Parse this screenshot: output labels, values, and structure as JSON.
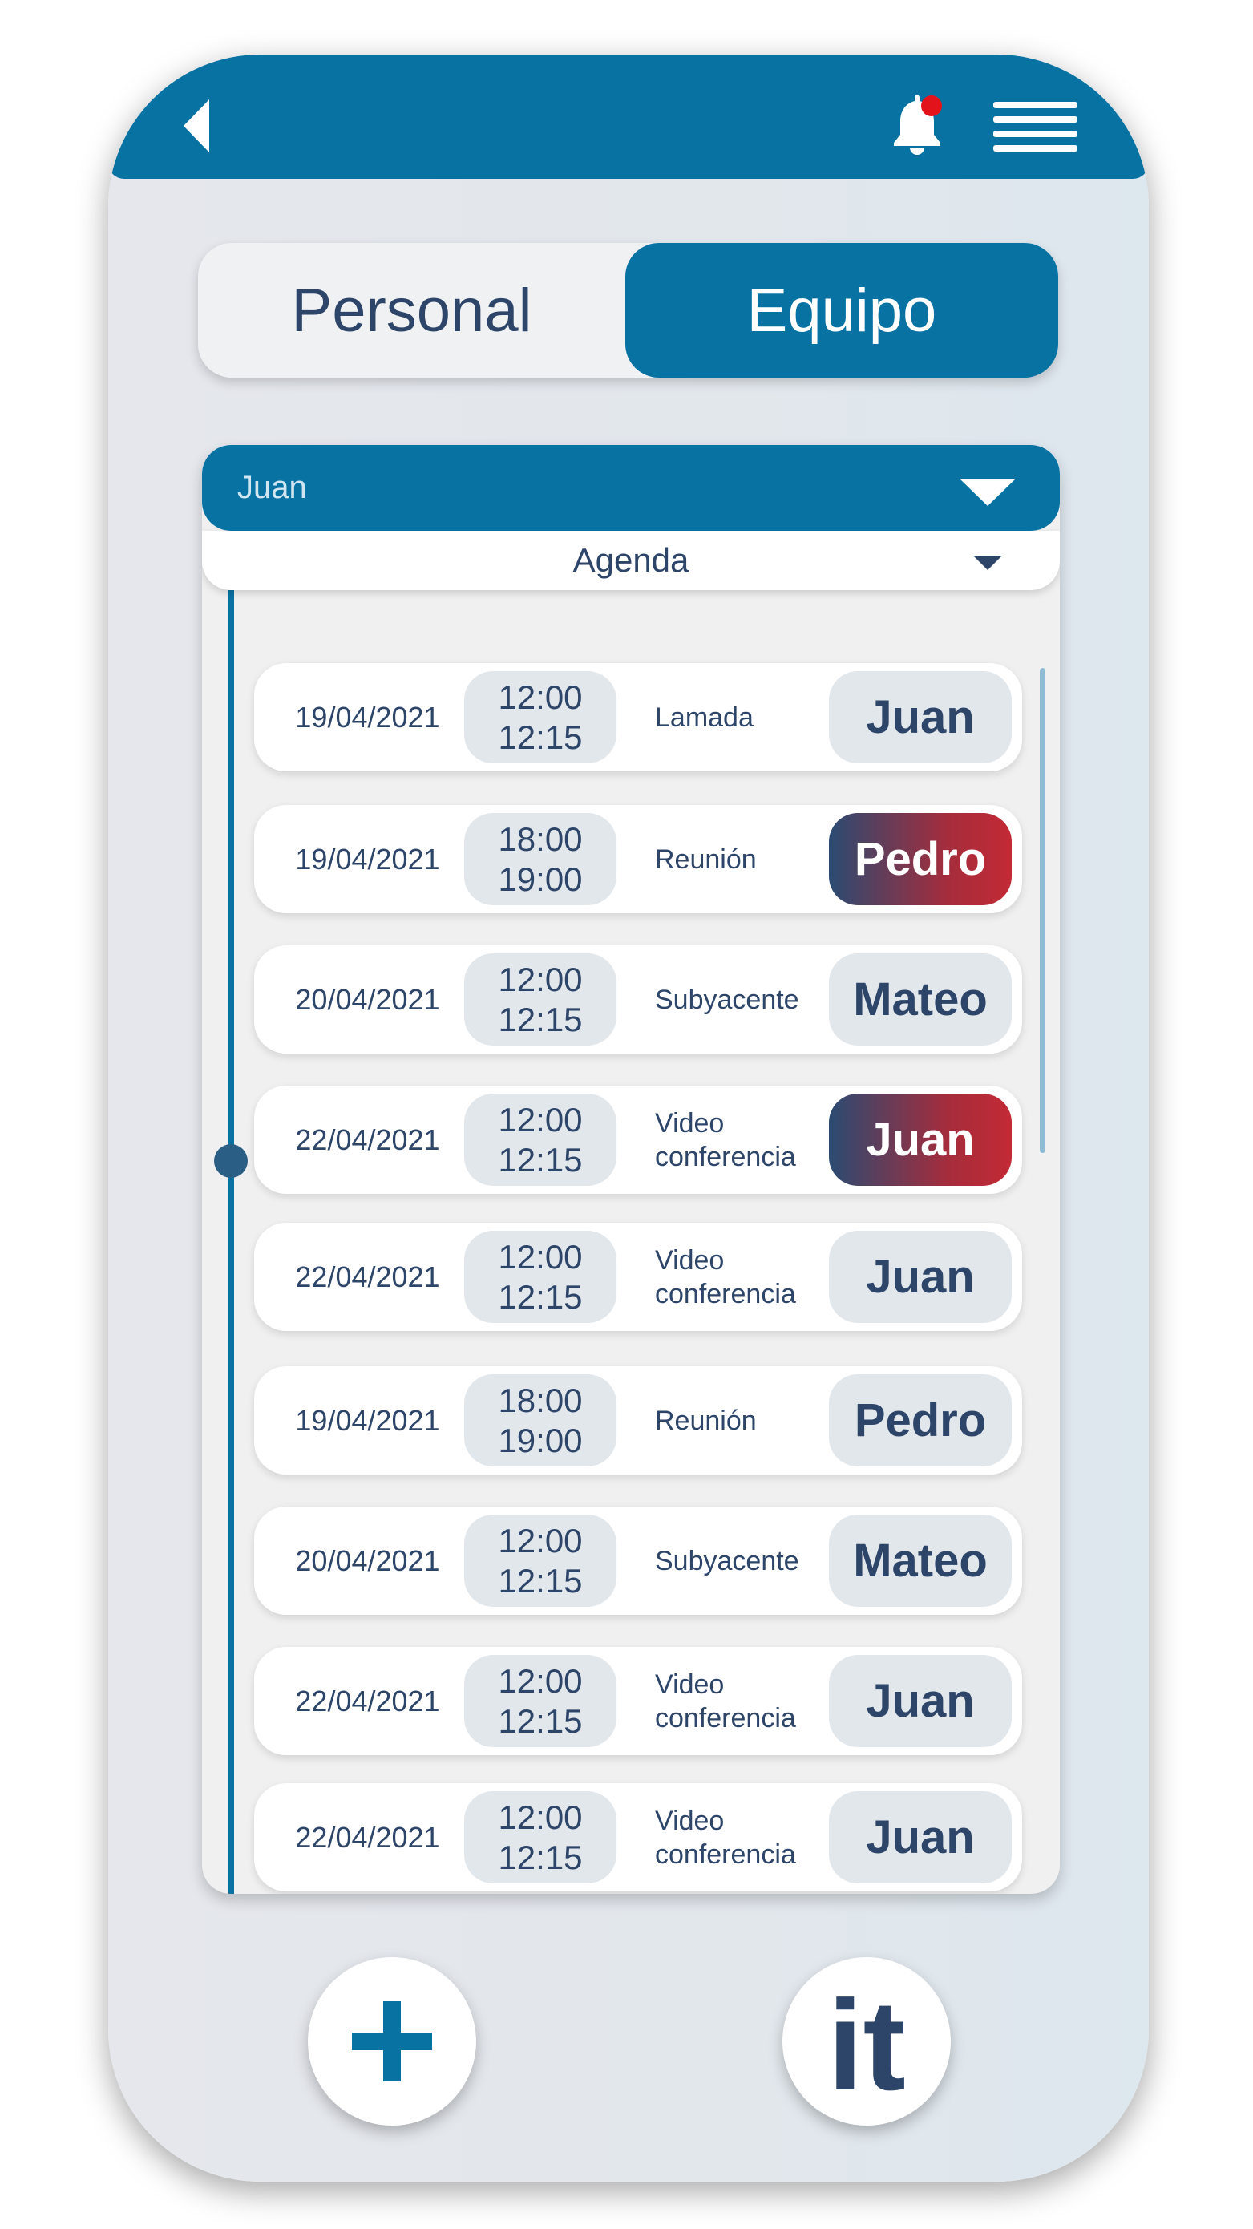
{
  "header": {
    "back_icon": "chevron-left-icon",
    "notification_icon": "bell-icon",
    "notification_badge_color": "#e2131b",
    "menu_icon": "hamburger-menu-icon"
  },
  "segments": {
    "personal": "Personal",
    "equipo": "Equipo",
    "selected": "Equipo"
  },
  "filters": {
    "user": "Juan",
    "view": "Agenda"
  },
  "entries": [
    {
      "date": "19/04/2021",
      "start": "12:00",
      "end": "12:15",
      "type": "Lamada",
      "person": "Juan",
      "highlight": false
    },
    {
      "date": "19/04/2021",
      "start": "18:00",
      "end": "19:00",
      "type": "Reunión",
      "person": "Pedro",
      "highlight": true
    },
    {
      "date": "20/04/2021",
      "start": "12:00",
      "end": "12:15",
      "type": "Subyacente",
      "person": "Mateo",
      "highlight": false
    },
    {
      "date": "22/04/2021",
      "start": "12:00",
      "end": "12:15",
      "type": "Video conferencia",
      "person": "Juan",
      "highlight": true
    },
    {
      "date": "22/04/2021",
      "start": "12:00",
      "end": "12:15",
      "type": "Video conferencia",
      "person": "Juan",
      "highlight": false
    },
    {
      "date": "19/04/2021",
      "start": "18:00",
      "end": "19:00",
      "type": "Reunión",
      "person": "Pedro",
      "highlight": false
    },
    {
      "date": "20/04/2021",
      "start": "12:00",
      "end": "12:15",
      "type": "Subyacente",
      "person": "Mateo",
      "highlight": false
    },
    {
      "date": "22/04/2021",
      "start": "12:00",
      "end": "12:15",
      "type": "Video conferencia",
      "person": "Juan",
      "highlight": false
    },
    {
      "date": "22/04/2021",
      "start": "12:00",
      "end": "12:15",
      "type": "Video conferencia",
      "person": "Juan",
      "highlight": false
    }
  ],
  "actions": {
    "add_icon": "plus-icon",
    "logo_text": "it"
  },
  "colors": {
    "primary": "#0872a3",
    "text": "#2d4569",
    "highlight_gradient_end": "#c32a35"
  }
}
